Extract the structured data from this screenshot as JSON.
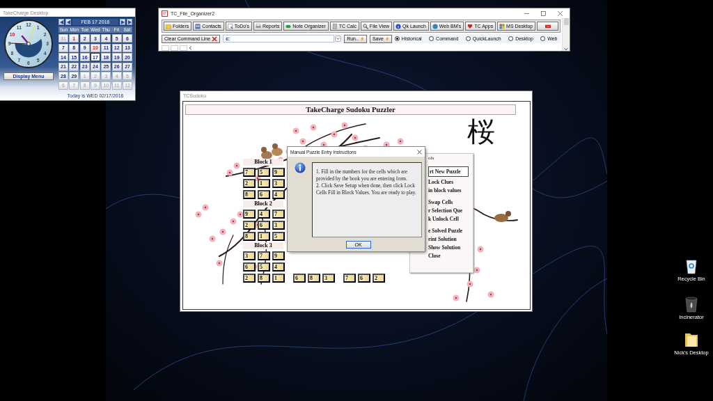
{
  "widget": {
    "title": "TakeCharge Desktop",
    "clock": {
      "numerals": [
        {
          "label": "12",
          "highlight": false
        },
        {
          "label": "1",
          "highlight": false
        },
        {
          "label": "2",
          "highlight": false
        },
        {
          "label": "3",
          "highlight": false
        },
        {
          "label": "4",
          "highlight": false
        },
        {
          "label": "5",
          "highlight": false
        },
        {
          "label": "6",
          "highlight": false
        },
        {
          "label": "7",
          "highlight": false
        },
        {
          "label": "8",
          "highlight": false
        },
        {
          "label": "9",
          "highlight": false
        },
        {
          "label": "10",
          "highlight": true
        },
        {
          "label": "11",
          "highlight": false
        }
      ]
    },
    "calendar": {
      "month_label": "FEB 17 2016",
      "weekdays": [
        "Sun",
        "Mon",
        "Tue",
        "Wed",
        "Thu",
        "Fri",
        "Sat"
      ],
      "weeks": [
        [
          {
            "label": "31",
            "muted": true,
            "holiday": false,
            "selected": false
          },
          {
            "label": "1",
            "muted": false,
            "holiday": true,
            "selected": false
          },
          {
            "label": "2",
            "muted": false,
            "holiday": false,
            "selected": false
          },
          {
            "label": "3",
            "muted": false,
            "holiday": false,
            "selected": false
          },
          {
            "label": "4",
            "muted": false,
            "holiday": false,
            "selected": false
          },
          {
            "label": "5",
            "muted": false,
            "holiday": false,
            "selected": false
          },
          {
            "label": "6",
            "muted": false,
            "holiday": false,
            "selected": false
          }
        ],
        [
          {
            "label": "7",
            "muted": false,
            "holiday": false,
            "selected": false
          },
          {
            "label": "8",
            "muted": false,
            "holiday": false,
            "selected": false
          },
          {
            "label": "9",
            "muted": false,
            "holiday": false,
            "selected": false
          },
          {
            "label": "10",
            "muted": false,
            "holiday": true,
            "selected": false
          },
          {
            "label": "11",
            "muted": false,
            "holiday": false,
            "selected": false
          },
          {
            "label": "12",
            "muted": false,
            "holiday": false,
            "selected": false
          },
          {
            "label": "13",
            "muted": false,
            "holiday": false,
            "selected": false
          }
        ],
        [
          {
            "label": "14",
            "muted": false,
            "holiday": false,
            "selected": false
          },
          {
            "label": "15",
            "muted": false,
            "holiday": false,
            "selected": false
          },
          {
            "label": "16",
            "muted": false,
            "holiday": false,
            "selected": false
          },
          {
            "label": "17",
            "muted": false,
            "holiday": false,
            "selected": true
          },
          {
            "label": "18",
            "muted": false,
            "holiday": false,
            "selected": false
          },
          {
            "label": "19",
            "muted": false,
            "holiday": false,
            "selected": false
          },
          {
            "label": "20",
            "muted": false,
            "holiday": false,
            "selected": false
          }
        ],
        [
          {
            "label": "21",
            "muted": false,
            "holiday": false,
            "selected": false
          },
          {
            "label": "22",
            "muted": false,
            "holiday": false,
            "selected": false
          },
          {
            "label": "23",
            "muted": false,
            "holiday": false,
            "selected": false
          },
          {
            "label": "24",
            "muted": false,
            "holiday": false,
            "selected": false
          },
          {
            "label": "25",
            "muted": false,
            "holiday": false,
            "selected": false
          },
          {
            "label": "26",
            "muted": false,
            "holiday": false,
            "selected": false
          },
          {
            "label": "27",
            "muted": false,
            "holiday": false,
            "selected": false
          }
        ],
        [
          {
            "label": "28",
            "muted": false,
            "holiday": false,
            "selected": false
          },
          {
            "label": "29",
            "muted": false,
            "holiday": false,
            "selected": false
          },
          {
            "label": "1",
            "muted": true,
            "holiday": false,
            "selected": false
          },
          {
            "label": "2",
            "muted": true,
            "holiday": false,
            "selected": false
          },
          {
            "label": "3",
            "muted": true,
            "holiday": false,
            "selected": false
          },
          {
            "label": "4",
            "muted": true,
            "holiday": false,
            "selected": false
          },
          {
            "label": "5",
            "muted": true,
            "holiday": false,
            "selected": false
          }
        ],
        [
          {
            "label": "6",
            "muted": true,
            "holiday": false,
            "selected": false
          },
          {
            "label": "7",
            "muted": true,
            "holiday": false,
            "selected": false
          },
          {
            "label": "8",
            "muted": true,
            "holiday": false,
            "selected": false
          },
          {
            "label": "9",
            "muted": true,
            "holiday": false,
            "selected": false
          },
          {
            "label": "10",
            "muted": true,
            "holiday": false,
            "selected": false
          },
          {
            "label": "11",
            "muted": true,
            "holiday": false,
            "selected": false
          },
          {
            "label": "12",
            "muted": true,
            "holiday": false,
            "selected": false
          }
        ]
      ]
    },
    "menu_button": "Display Menu",
    "today": "Today is WED 02/17/2016"
  },
  "organizer": {
    "title": "TC_File_Organizer2",
    "toolbar": [
      {
        "label": "Folders"
      },
      {
        "label": "Contacts"
      },
      {
        "label": "ToDo's"
      },
      {
        "label": "Reports"
      },
      {
        "label": "Note Organizer"
      },
      {
        "label": "TC Calc"
      },
      {
        "label": "File View"
      },
      {
        "label": "Qk Launch"
      },
      {
        "label": "Web BM's"
      },
      {
        "label": "TC Apps"
      },
      {
        "label": "MS Desktop"
      }
    ],
    "clear_button": "Clear Command Line",
    "command": {
      "value": "c:"
    },
    "run_button": "Run..",
    "save_button": "Save",
    "modes": [
      {
        "label": "Historical",
        "selected": true
      },
      {
        "label": "Command",
        "selected": false
      },
      {
        "label": "QuickLaunch",
        "selected": false
      },
      {
        "label": "Desktop",
        "selected": false
      },
      {
        "label": "Web",
        "selected": false
      }
    ]
  },
  "sudoku": {
    "title": "TCSudoku",
    "heading": "TakeCharge Sudoku Puzzler",
    "kanji": "桜",
    "blocks": [
      {
        "label": "Block 1",
        "rows": [
          [
            "7",
            "5",
            "9"
          ],
          [
            "2",
            "1",
            "3"
          ],
          [
            "8",
            "6",
            "4"
          ]
        ]
      },
      {
        "label": "Block 2",
        "rows": [
          [
            "9",
            "4",
            "7"
          ],
          [
            "2",
            "6",
            "3"
          ],
          [
            "8",
            "1",
            "5"
          ]
        ]
      },
      {
        "label": "Block 3",
        "rows": [
          [
            "3",
            "7",
            "9"
          ],
          [
            "6",
            "5",
            "4"
          ],
          [
            "2",
            "8",
            "1",
            "6",
            "8",
            "3",
            "7",
            "6",
            "2"
          ]
        ]
      }
    ],
    "tools_legend": "ols",
    "tool_groups": [
      {
        "items": [
          {
            "label": "rt New Puzzle",
            "kind": "button"
          },
          {
            "label": "Lock Clues",
            "kind": "link"
          },
          {
            "label": "in block values",
            "kind": "link"
          }
        ]
      },
      {
        "items": [
          {
            "label": "Swap Cells",
            "kind": "link"
          },
          {
            "label": "r Selection Que",
            "kind": "link"
          },
          {
            "label": "k Unlock Cell",
            "kind": "link"
          }
        ]
      },
      {
        "items": [
          {
            "label": "e Solved Puzzle",
            "kind": "link"
          },
          {
            "label": "rint Solution",
            "kind": "link"
          },
          {
            "label": "Show Solution",
            "kind": "link"
          },
          {
            "label": "Close",
            "kind": "link"
          }
        ]
      }
    ]
  },
  "dialog": {
    "title": "Manual Puzzle Entry Instructions",
    "lines": [
      "1.  Fill in the numbers for the cells which are provided by the book you are entering from.",
      "2.  Click Save Setup when done, then click Lock Cells Fill in Block Values. You are ready to play."
    ],
    "ok_button": "OK"
  },
  "desktop_icons": [
    {
      "label": "Recycle Bin",
      "kind": "bin"
    },
    {
      "label": "Incinerator",
      "kind": "incinerator"
    },
    {
      "label": "Nick's Desktop",
      "kind": "folder"
    }
  ]
}
